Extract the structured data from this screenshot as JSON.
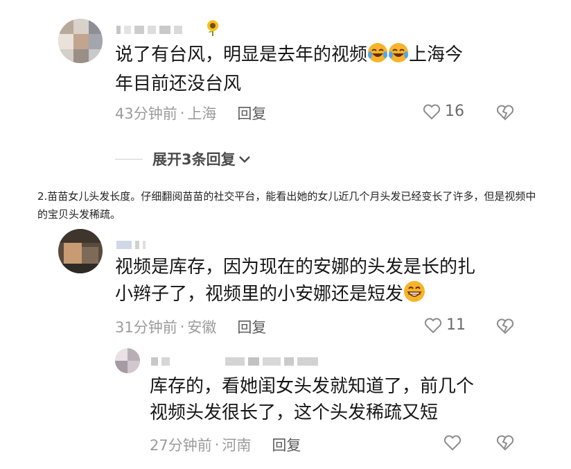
{
  "comments": [
    {
      "text_line1": "说了有台风，明显是去年的视频",
      "text_after_emoji": "上海今",
      "text_line2": "年目前还没台风",
      "time": "43分钟前",
      "sep": "·",
      "location": "上海",
      "reply_label": "回复",
      "likes": "16",
      "emoji": "laughing-tears-emoji x2",
      "name_decoration": "sunflower-icon"
    },
    {
      "text_line1": "视频是库存，因为现在的安娜的头发是长的扎",
      "text_line2": "小辫子了，视频里的小安娜还是短发",
      "time": "31分钟前",
      "sep": "·",
      "location": "安徽",
      "reply_label": "回复",
      "likes": "11",
      "emoji": "grinning-emoji"
    },
    {
      "text_line1": "库存的，看她闺女头发就知道了，前几个",
      "text_line2": "视频头发很长了，这个头发稀疏又短",
      "time": "27分钟前",
      "sep": "·",
      "location": "河南",
      "reply_label": "回复"
    }
  ],
  "expand_replies": "展开3条回复",
  "article_text": "2.苗苗女儿头发长度。仔细翻阅苗苗的社交平台，能看出她的女儿近几个月头发已经变长了许多，但是视频中的宝贝头发稀疏。",
  "colors": {
    "text": "#161616",
    "meta": "#9b9b9b",
    "reply": "#5c5c5c",
    "emoji": "#f7b32b"
  }
}
